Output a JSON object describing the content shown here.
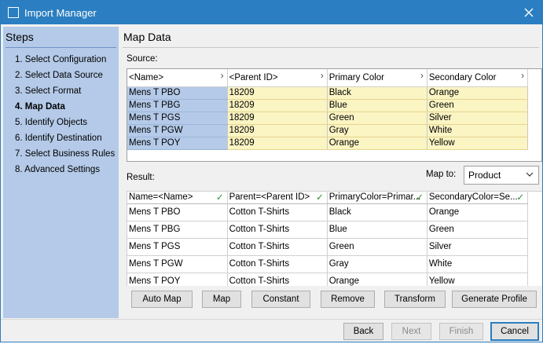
{
  "window": {
    "title": "Import Manager"
  },
  "sidebar": {
    "title": "Steps",
    "steps": [
      "1. Select Configuration",
      "2. Select Data Source",
      "3. Select Format",
      "4. Map Data",
      "5. Identify Objects",
      "6. Identify Destination",
      "7. Select Business Rules",
      "8. Advanced Settings"
    ],
    "active_index": 3
  },
  "main": {
    "title": "Map Data",
    "source_label": "Source:",
    "result_label": "Result:",
    "map_to_label": "Map to:",
    "map_to_value": "Product"
  },
  "source": {
    "headers": [
      "<Name>",
      "<Parent ID>",
      "Primary Color",
      "Secondary Color"
    ],
    "rows": [
      [
        "Mens T PBO",
        "18209",
        "Black",
        "Orange"
      ],
      [
        "Mens T PBG",
        "18209",
        "Blue",
        "Green"
      ],
      [
        "Mens T PGS",
        "18209",
        "Green",
        "Silver"
      ],
      [
        "Mens T PGW",
        "18209",
        "Gray",
        "White"
      ],
      [
        "Mens T POY",
        "18209",
        "Orange",
        "Yellow"
      ]
    ]
  },
  "result": {
    "headers": [
      "Name=<Name>",
      "Parent=<Parent ID>",
      "PrimaryColor=Primar...",
      "SecondaryColor=Se..."
    ],
    "rows": [
      [
        "Mens T PBO",
        "Cotton T-Shirts",
        "Black",
        "Orange"
      ],
      [
        "Mens T PBG",
        "Cotton T-Shirts",
        "Blue",
        "Green"
      ],
      [
        "Mens T PGS",
        "Cotton T-Shirts",
        "Green",
        "Silver"
      ],
      [
        "Mens T PGW",
        "Cotton T-Shirts",
        "Gray",
        "White"
      ],
      [
        "Mens T POY",
        "Cotton T-Shirts",
        "Orange",
        "Yellow"
      ]
    ]
  },
  "actions": {
    "auto_map": "Auto Map",
    "map": "Map",
    "constant": "Constant",
    "remove": "Remove",
    "transform": "Transform",
    "generate_profile": "Generate Profile"
  },
  "footer": {
    "back": "Back",
    "next": "Next",
    "finish": "Finish",
    "cancel": "Cancel"
  },
  "icons": {
    "sort_arrow": "chevron-right-icon",
    "mapped_check": "check-icon",
    "dropdown": "chevron-down-icon",
    "close": "close-icon"
  },
  "colors": {
    "titlebar": "#2b7ec1",
    "sidebar": "#b4cae8",
    "source_cell": "#fbf4c3",
    "check": "#2a8a2a"
  }
}
